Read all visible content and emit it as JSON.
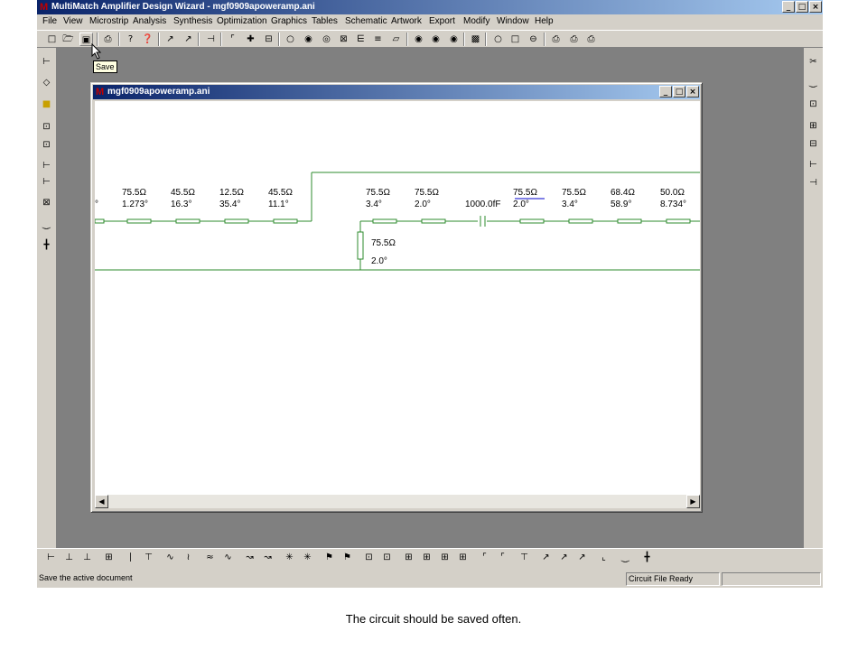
{
  "app": {
    "title": "MultiMatch Amplifier Design Wizard - mgf0909apoweramp.ani",
    "logo": "M",
    "window_buttons": [
      "_",
      "□",
      "×"
    ]
  },
  "menu": [
    "File",
    "View",
    "Microstrip",
    "Analysis",
    "Synthesis",
    "Optimization",
    "Graphics",
    "Tables",
    "Schematic",
    "Artwork",
    "Export",
    "Modify",
    "Window",
    "Help"
  ],
  "toolbar": {
    "tooltip": "Save",
    "buttons": [
      "new-document",
      "open-folder",
      "save-disk",
      "print",
      "help",
      "whats-this",
      "pointer-a",
      "pointer-b",
      "insert",
      "wire-a",
      "cross",
      "box",
      "circle-1",
      "circle-2",
      "circle-3",
      "cross-box",
      "filter-a",
      "equal",
      "shape",
      "circle-4",
      "circle-5",
      "circle-6",
      "amplifier",
      "circle-7",
      "square",
      "circle-8",
      "print-a",
      "print-b",
      "print-c"
    ]
  },
  "child_window": {
    "title": "mgf0909apoweramp.ani",
    "buttons": [
      "_",
      "□",
      "×"
    ]
  },
  "schematic": {
    "elements": [
      {
        "z": "",
        "e": "°"
      },
      {
        "z": "75.5Ω",
        "e": "1.273°"
      },
      {
        "z": "45.5Ω",
        "e": "16.3°"
      },
      {
        "z": "12.5Ω",
        "e": "35.4°"
      },
      {
        "z": "45.5Ω",
        "e": "11.1°"
      },
      {
        "z": "75.5Ω",
        "e": "3.4°"
      },
      {
        "z": "75.5Ω",
        "e": "2.0°"
      },
      {
        "z": "",
        "e": "1000.0fF"
      },
      {
        "z": "75.5Ω",
        "e": "2.0°"
      },
      {
        "z": "75.5Ω",
        "e": "3.4°"
      },
      {
        "z": "68.4Ω",
        "e": "58.9°"
      },
      {
        "z": "50.0Ω",
        "e": "8.734°"
      }
    ],
    "stub": {
      "z": "75.5Ω",
      "e": "2.0°"
    },
    "colors": {
      "line": "#2e8b2e",
      "highlight": "#0000cc"
    }
  },
  "status": {
    "message": "Save the active document",
    "state": "Circuit File Ready"
  },
  "caption": "The circuit should be saved often."
}
